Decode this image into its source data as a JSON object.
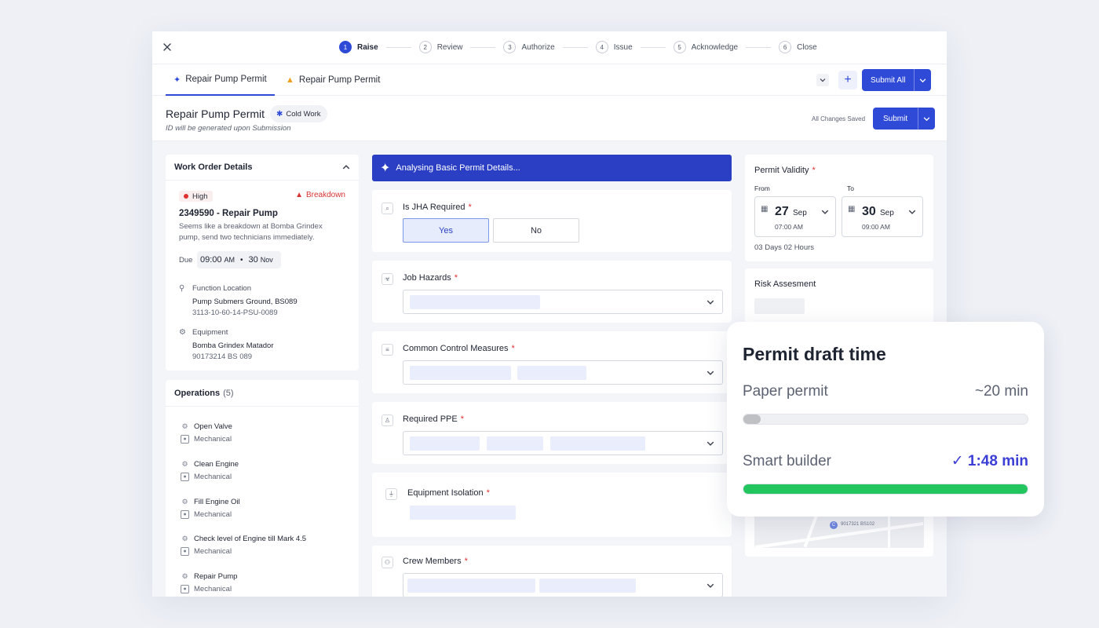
{
  "stepper": {
    "steps": [
      {
        "num": "1",
        "label": "Raise",
        "active": true
      },
      {
        "num": "2",
        "label": "Review",
        "active": false
      },
      {
        "num": "3",
        "label": "Authorize",
        "active": false
      },
      {
        "num": "4",
        "label": "Issue",
        "active": false
      },
      {
        "num": "5",
        "label": "Acknowledge",
        "active": false
      },
      {
        "num": "6",
        "label": "Close",
        "active": false
      }
    ]
  },
  "tabs": {
    "items": [
      {
        "label": "Repair Pump Permit",
        "icon": "sparkle-icon",
        "active": true
      },
      {
        "label": "Repair Pump Permit",
        "icon": "hardhat-icon",
        "active": false
      }
    ],
    "submit_all_label": "Submit All"
  },
  "header": {
    "title": "Repair Pump Permit",
    "badge": "Cold Work",
    "subnote": "ID will be generated upon Submission",
    "saved": "All Changes Saved",
    "submit_label": "Submit"
  },
  "work_order": {
    "heading": "Work Order Details",
    "priority": "High",
    "type": "Breakdown",
    "title": "2349590 - Repair Pump",
    "description": "Seems like a breakdown at Bomba Grindex pump, send two technicians immediately.",
    "due_label": "Due",
    "due_time": "09:00",
    "due_ampm": "AM",
    "due_day": "30",
    "due_month": "Nov",
    "function_location_label": "Function Location",
    "function_location": "Pump Submers Ground, BS089",
    "function_location_code": "3113-10-60-14-PSU-0089",
    "equipment_label": "Equipment",
    "equipment": "Bomba Grindex Matador",
    "equipment_code": "90173214 BS 089"
  },
  "operations": {
    "heading": "Operations",
    "count": "(5)",
    "items": [
      {
        "name": "Open Valve",
        "trade": "Mechanical"
      },
      {
        "name": "Clean Engine",
        "trade": "Mechanical"
      },
      {
        "name": "Fill Engine Oil",
        "trade": "Mechanical"
      },
      {
        "name": "Check level of Engine till Mark 4.5",
        "trade": "Mechanical"
      },
      {
        "name": "Repair Pump",
        "trade": "Mechanical"
      }
    ]
  },
  "form": {
    "ai_banner": "Analysing Basic Permit Details...",
    "jha_label": "Is JHA Required",
    "yes": "Yes",
    "no": "No",
    "job_hazards": "Job Hazards",
    "control_measures": "Common Control Measures",
    "ppe": "Required PPE",
    "isolation": "Equipment Isolation",
    "crew": "Crew Members",
    "required_mark": "*"
  },
  "validity": {
    "title": "Permit Validity",
    "from_label": "From",
    "to_label": "To",
    "from_day": "27",
    "from_month": "Sep",
    "from_time": "07:00 AM",
    "to_day": "30",
    "to_month": "Sep",
    "to_time": "09:00 AM",
    "duration": "03 Days 02 Hours"
  },
  "risk": {
    "title": "Risk Assesment",
    "map_label": "9017321 BS102"
  },
  "popup": {
    "title": "Permit draft time",
    "paper_label": "Paper permit",
    "paper_time": "~20 min",
    "paper_progress": 0.06,
    "smart_label": "Smart builder",
    "smart_time": "✓ 1:48 min",
    "smart_progress": 1.0,
    "paper_color": "#bfc0c4",
    "smart_color": "#22c55e"
  }
}
